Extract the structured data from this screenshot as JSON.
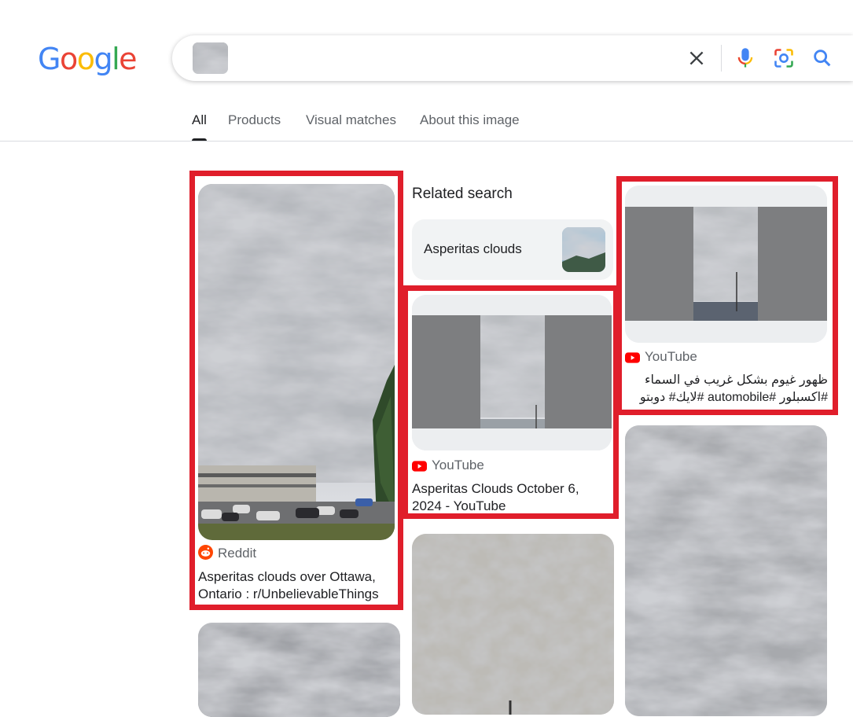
{
  "logo": {
    "letters": [
      "G",
      "o",
      "o",
      "g",
      "l",
      "e"
    ]
  },
  "search": {
    "query_image": "cloud-thumbnail",
    "icons": [
      "close-icon",
      "mic-icon",
      "lens-icon",
      "search-icon"
    ]
  },
  "tabs": [
    {
      "label": "All",
      "active": true
    },
    {
      "label": "Products",
      "active": false
    },
    {
      "label": "Visual matches",
      "active": false
    },
    {
      "label": "About this image",
      "active": false
    }
  ],
  "related": {
    "title": "Related search",
    "chip_label": "Asperitas clouds"
  },
  "results": [
    {
      "source": "Reddit",
      "title": "Asperitas clouds over Ottawa, Ontario : r/UnbelievableThings"
    },
    {
      "source": "YouTube",
      "title": "Asperitas Clouds October 6, 2024 - YouTube"
    },
    {
      "source": "YouTube",
      "title": "ظهور غيوم بشكل غريب في السماء #اكسبلور #automobile #لايك# دوبتو #travel..."
    }
  ],
  "colors": {
    "highlight": "#e01e2b",
    "youtube": "#ff0000",
    "reddit": "#ff4500"
  }
}
